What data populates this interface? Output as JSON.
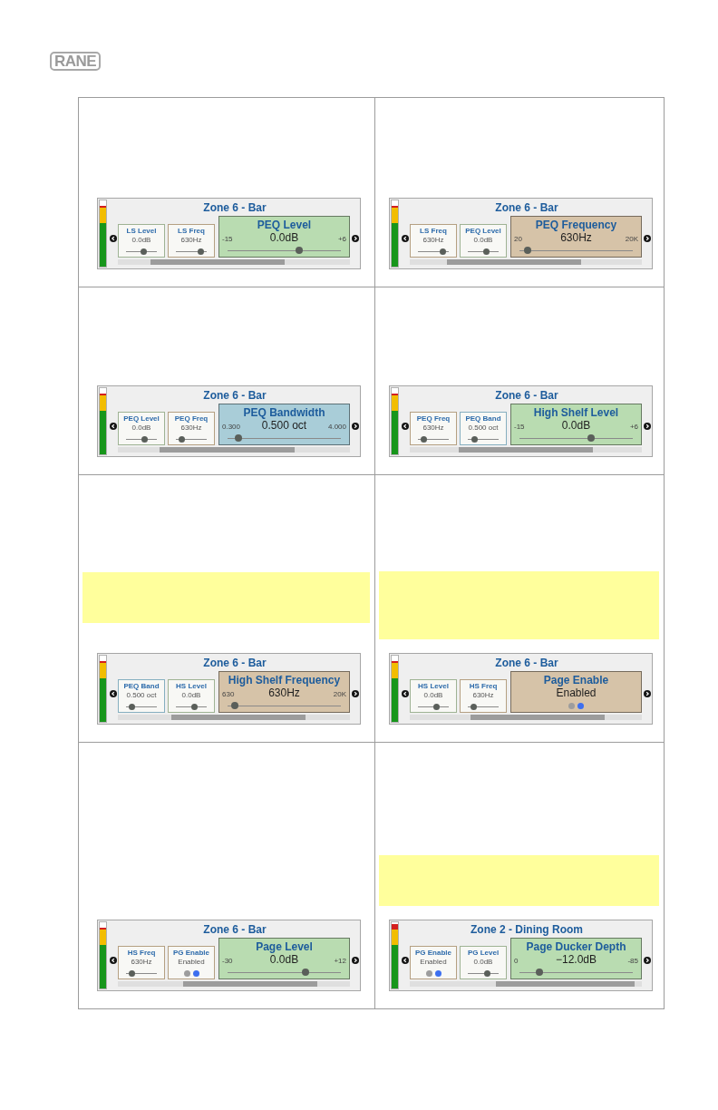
{
  "header": {
    "logo": "RANE"
  },
  "cells": [
    {
      "panel": {
        "zone": "Zone 6 - Bar",
        "meter": {
          "level": 0.92
        },
        "params": [
          {
            "kind": "slider",
            "label": "LS Level",
            "value": "0.0dB",
            "level": 0.6,
            "color": "#9fb394"
          },
          {
            "kind": "slider",
            "label": "LS Freq",
            "value": "630Hz",
            "level": 0.9,
            "color": "#b5a082"
          }
        ],
        "main": {
          "kind": "slider",
          "label": "PEQ Level",
          "value": "0.0dB",
          "min": "-15",
          "max": "+6",
          "level": 0.64,
          "color": "#b9dcb1"
        }
      }
    },
    {
      "panel": {
        "zone": "Zone 6 - Bar",
        "meter": {
          "level": 0.92
        },
        "params": [
          {
            "kind": "slider",
            "label": "LS Freq",
            "value": "630Hz",
            "level": 0.9,
            "color": "#b5a082"
          },
          {
            "kind": "slider",
            "label": "PEQ Level",
            "value": "0.0dB",
            "level": 0.62,
            "color": "#9fb394"
          }
        ],
        "main": {
          "kind": "slider",
          "label": "PEQ Frequency",
          "value": "630Hz",
          "min": "20",
          "max": "20K",
          "level": 0.04,
          "color": "#d6c3a8"
        }
      }
    },
    {
      "panel": {
        "zone": "Zone 6 - Bar",
        "meter": {
          "level": 0.92
        },
        "params": [
          {
            "kind": "slider",
            "label": "PEQ Level",
            "value": "0.0dB",
            "level": 0.62,
            "color": "#9fb394"
          },
          {
            "kind": "slider",
            "label": "PEQ Freq",
            "value": "630Hz",
            "level": 0.12,
            "color": "#b5a082"
          }
        ],
        "main": {
          "kind": "slider",
          "label": "PEQ Bandwidth",
          "value": "0.500 oct",
          "min": "0.300",
          "max": "4.000",
          "level": 0.07,
          "color": "#a9cdd8"
        }
      }
    },
    {
      "panel": {
        "zone": "Zone 6 - Bar",
        "meter": {
          "level": 0.92
        },
        "params": [
          {
            "kind": "slider",
            "label": "PEQ Freq",
            "value": "630Hz",
            "level": 0.12,
            "color": "#b5a082"
          },
          {
            "kind": "slider",
            "label": "PEQ Band",
            "value": "0.500 oct",
            "level": 0.15,
            "color": "#86afc0"
          }
        ],
        "main": {
          "kind": "slider",
          "label": "High Shelf Level",
          "value": "0.0dB",
          "min": "-15",
          "max": "+6",
          "level": 0.64,
          "color": "#b9dcb1"
        }
      }
    },
    {
      "highlight": {
        "kind": "short"
      },
      "panel": {
        "zone": "Zone 6 - Bar",
        "meter": {
          "level": 0.92
        },
        "params": [
          {
            "kind": "slider",
            "label": "PEQ Band",
            "value": "0.500 oct",
            "level": 0.12,
            "color": "#86afc0"
          },
          {
            "kind": "slider",
            "label": "HS Level",
            "value": "0.0dB",
            "level": 0.62,
            "color": "#9fb394"
          }
        ],
        "main": {
          "kind": "slider",
          "label": "High Shelf Frequency",
          "value": "630Hz",
          "min": "630",
          "max": "20K",
          "level": 0.03,
          "color": "#d6c3a8"
        }
      }
    },
    {
      "highlight": {
        "kind": "tall"
      },
      "panel": {
        "zone": "Zone 6 - Bar",
        "meter": {
          "level": 0.92
        },
        "params": [
          {
            "kind": "slider",
            "label": "HS Level",
            "value": "0.0dB",
            "level": 0.62,
            "color": "#9fb394"
          },
          {
            "kind": "slider",
            "label": "HS Freq",
            "value": "630Hz",
            "level": 0.12,
            "color": "#b5a082"
          }
        ],
        "main": {
          "kind": "toggle",
          "label": "Page Enable",
          "value": "Enabled",
          "on": true,
          "color": "#d6c3a8"
        }
      }
    },
    {
      "panel": {
        "zone": "Zone 6 - Bar",
        "meter": {
          "level": 0.92
        },
        "params": [
          {
            "kind": "slider",
            "label": "HS Freq",
            "value": "630Hz",
            "level": 0.1,
            "color": "#b5a082"
          },
          {
            "kind": "toggle",
            "label": "PG Enable",
            "value": "Enabled",
            "on": true,
            "color": "#b5a082"
          }
        ],
        "main": {
          "kind": "slider",
          "label": "Page Level",
          "value": "0.0dB",
          "min": "-30",
          "max": "+12",
          "level": 0.7,
          "color": "#b9dcb1"
        }
      }
    },
    {
      "highlight": {
        "kind": "short"
      },
      "panel": {
        "zone": "Zone 2 - Dining Room",
        "meter": {
          "level": 0.97
        },
        "params": [
          {
            "kind": "toggle",
            "label": "PG Enable",
            "value": "Enabled",
            "on": true,
            "color": "#b5a082"
          },
          {
            "kind": "slider",
            "label": "PG Level",
            "value": "0.0dB",
            "level": 0.68,
            "color": "#9fb394"
          }
        ],
        "main": {
          "kind": "slider",
          "label": "Page Ducker Depth",
          "value": "−12.0dB",
          "min": "0",
          "max": "-85",
          "level": 0.15,
          "color": "#b9dcb1"
        }
      }
    }
  ]
}
